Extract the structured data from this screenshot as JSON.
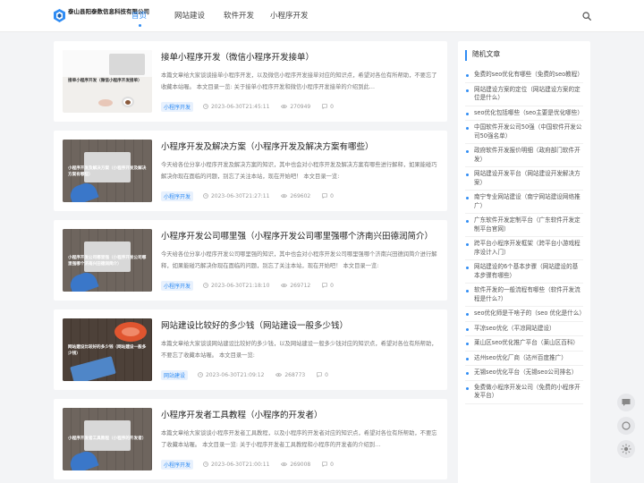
{
  "header": {
    "logo_text": "泰山县阳泰数信息科技有限公司",
    "nav": [
      "首页",
      "网站建设",
      "软件开发",
      "小程序开发"
    ]
  },
  "articles": [
    {
      "title": "接单小程序开发（微信小程序开发接单）",
      "excerpt": "本篇文章给大家谈谈接单小程序开发，以及微信小程序开发接单对应的知识点，希望对各位有所帮助，不要忘了收藏本站喔。 本文目录一览: 关于接单小程序开发和微信小程序开发接单的介绍到此…",
      "thumb_text": "接单小程序开发（微信小程序开发接单）",
      "tag": "小程序开发",
      "time": "2023-06-30T21:45:11",
      "views": "270949",
      "comments": "0"
    },
    {
      "title": "小程序开发及解决方案（小程序开发及解决方案有哪些）",
      "excerpt": "今天给各位分享小程序开发及解决方案的知识，其中也会对小程序开发及解决方案有哪些进行解释，如果能碰巧解决你现在面临的问题，别忘了关注本站，现在开始吧！ 本文目录一览:",
      "thumb_text": "小程序开发及解决方案（小程序开发及解决方案有哪些）",
      "tag": "小程序开发",
      "time": "2023-06-30T21:27:11",
      "views": "269602",
      "comments": "0"
    },
    {
      "title": "小程序开发公司哪里强（小程序开发公司哪里强哪个济南兴田德润简介）",
      "excerpt": "今天给各位分享小程序开发公司哪里强的知识，其中也会对小程序开发公司哪里强哪个济南兴田德润简介进行解释，如果能碰巧解决你现在面临的问题，别忘了关注本站，现在开始吧！ 本文目录一览:",
      "thumb_text": "小程序开发公司哪里强（小程序开发公司哪里强哪个济南兴田德润简介）",
      "tag": "小程序开发",
      "time": "2023-06-30T21:18:10",
      "views": "269712",
      "comments": "0"
    },
    {
      "title": "网站建设比较好的多少钱（网站建设一般多少钱）",
      "excerpt": "本篇文章给大家谈谈网站建设比较好的多少钱，以及网站建设一般多少钱对应的知识点，希望对各位有所帮助，不要忘了收藏本站喔。 本文目录一览:",
      "thumb_text": "网站建设比较好的多少钱（网站建设一般多少钱）",
      "tag": "网站建设",
      "time": "2023-06-30T21:09:12",
      "views": "268773",
      "comments": "0"
    },
    {
      "title": "小程序开发者工具教程（小程序的开发者）",
      "excerpt": "本篇文章给大家谈谈小程序开发者工具教程，以及小程序的开发者对应的知识点，希望对各位有所帮助，不要忘了收藏本站喔。 本文目录一览: 关于小程序开发者工具教程和小程序的开发者的介绍到…",
      "thumb_text": "小程序开发者工具教程（小程序的开发者）",
      "tag": "小程序开发",
      "time": "2023-06-30T21:00:11",
      "views": "269008",
      "comments": "0"
    }
  ],
  "sidebar": {
    "title": "随机文章",
    "items": [
      "免费的seo优化有哪些（免费的seo教程）",
      "网站建设方案的定位（网站建设方案的定位是什么）",
      "seo优化包括哪些（seo主要是优化哪些）",
      "中国软件开发公司50强（中国软件开发公司50强名单）",
      "政府软件开发报价明细（政府部门软件开发）",
      "网站建设开发平台（网站建设开发解决方案）",
      "南宁专业网站建设（南宁网站建设网络推广）",
      "广东软件开发定制平台（广东软件开发定制平台官网）",
      "跨平台小程序开发框架（跨平台小游戏程序设计入门）",
      "网站建设的6个基本步骤（网站建设的基本步骤有哪些）",
      "软件开发的一般流程有哪些（软件开发流程是什么?）",
      "seo优化师是干啥子的（seo 优化是什么）",
      "平凉seo优化（平凉网站建设）",
      "莱山区seo优化推广平台（莱山区百科）",
      "达州seo优化厂商（达州百度推广）",
      "无锡seo优化平台（无锡seo公司排名）",
      "免费做小程序开发公司（免费的小程序开发平台）"
    ]
  },
  "icons": {
    "search": "search-icon",
    "clock": "clock-icon",
    "eye": "eye-icon",
    "comment": "comment-icon",
    "chat": "chat-icon",
    "moon": "moon-icon",
    "sun": "sun-icon"
  },
  "colors": {
    "accent": "#2f8cf4",
    "tag_bg": "#e8f1fd",
    "page_bg": "#f3f4f6"
  }
}
